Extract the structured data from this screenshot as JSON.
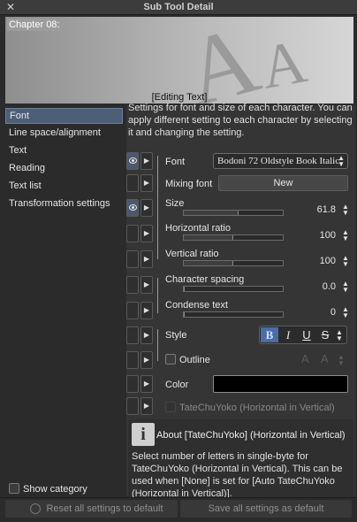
{
  "window": {
    "title": "Sub Tool Detail",
    "close_glyph": "✕"
  },
  "preview": {
    "chapter": "Chapter 08:",
    "caption": "[Editing Text]",
    "sample_glyphs": "AA"
  },
  "categories": [
    {
      "label": "Font",
      "selected": true
    },
    {
      "label": "Line space/alignment",
      "selected": false
    },
    {
      "label": "Text",
      "selected": false
    },
    {
      "label": "Reading",
      "selected": false
    },
    {
      "label": "Text list",
      "selected": false
    },
    {
      "label": "Transformation settings",
      "selected": false
    }
  ],
  "show_category": {
    "label": "Show category",
    "checked": false
  },
  "description": "Settings for font and size of each character. You can apply different setting to each character by selecting it and changing the setting.",
  "props": {
    "font": {
      "label": "Font",
      "value": "Bodoni 72 Oldstyle Book Italic"
    },
    "mixing_font": {
      "label": "Mixing font",
      "button": "New"
    },
    "size": {
      "label": "Size",
      "value": "61.8",
      "fill": 0.55
    },
    "horizontal_ratio": {
      "label": "Horizontal ratio",
      "value": "100",
      "fill": 0.5
    },
    "vertical_ratio": {
      "label": "Vertical ratio",
      "value": "100",
      "fill": 0.5
    },
    "character_spacing": {
      "label": "Character spacing",
      "value": "0.0",
      "fill": 0.0
    },
    "condense_text": {
      "label": "Condense text",
      "value": "0",
      "fill": 0.0
    },
    "style": {
      "label": "Style",
      "bold": "B",
      "italic": "I",
      "underline": "U",
      "strike": "S"
    },
    "outline": {
      "label": "Outline",
      "checked": false
    },
    "color": {
      "label": "Color",
      "value": "#000000"
    },
    "tatechuyoko": {
      "label": "TateChuYoko (Horizontal in Vertical)",
      "checked": false
    }
  },
  "about": {
    "icon": "i",
    "heading": "About [TateChuYoko] (Horizontal in Vertical)",
    "text": "Select number of letters in single-byte for TateChuYoko (Horizontal in Vertical). This can be used when [None] is set for [Auto TateChuYoko (Horizontal in Vertical)]."
  },
  "footer": {
    "reset": "Reset all settings to default",
    "save": "Save all settings as default"
  },
  "icons": {
    "eye": "eye-icon",
    "arrow": "▶",
    "spin": "▲▼",
    "outline_a": "A"
  }
}
